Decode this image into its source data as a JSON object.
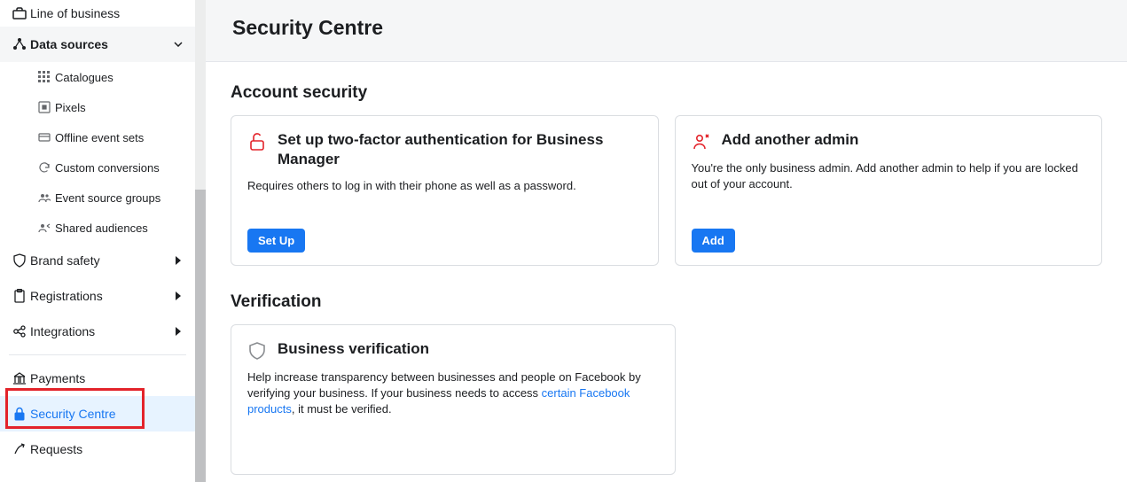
{
  "sidebar": {
    "lob": "Line of business",
    "data_sources": "Data sources",
    "subs": {
      "catalogues": "Catalogues",
      "pixels": "Pixels",
      "offline": "Offline event sets",
      "custom": "Custom conversions",
      "esg": "Event source groups",
      "shared": "Shared audiences"
    },
    "brand_safety": "Brand safety",
    "registrations": "Registrations",
    "integrations": "Integrations",
    "payments": "Payments",
    "security_centre": "Security Centre",
    "requests": "Requests"
  },
  "header": {
    "title": "Security Centre"
  },
  "sections": {
    "account_security": {
      "title": "Account security",
      "card_2fa": {
        "title": "Set up two-factor authentication for Business Manager",
        "body": "Requires others to log in with their phone as well as a password.",
        "cta": "Set Up"
      },
      "card_admin": {
        "title": "Add another admin",
        "body": "You're the only business admin. Add another admin to help if you are locked out of your account.",
        "cta": "Add"
      }
    },
    "verification": {
      "title": "Verification",
      "card_bv": {
        "title": "Business verification",
        "body_pre": "Help increase transparency between businesses and people on Facebook by verifying your business. If your business needs to access ",
        "link": "certain Facebook products",
        "body_post": ", it must be verified."
      }
    }
  }
}
